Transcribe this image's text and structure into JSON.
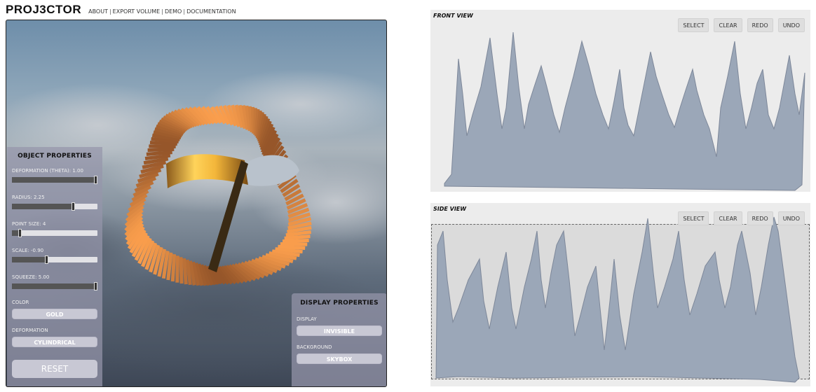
{
  "app": {
    "title": "PROJ3CTOR",
    "nav": [
      "ABOUT",
      "EXPORT VOLUME",
      "DEMO",
      "DOCUMENTATION"
    ],
    "nav_separator": "|"
  },
  "object_properties": {
    "title": "OBJECT PROPERTIES",
    "sliders": [
      {
        "label": "DEFORMATION (THETA): 1.00",
        "level": 1.0
      },
      {
        "label": "RADIUS: 2.25",
        "level": 0.72
      },
      {
        "label": "POINT SIZE: 4",
        "level": 0.1
      },
      {
        "label": "SCALE: -0.90",
        "level": 0.41
      },
      {
        "label": "SQUEEZE: 5.00",
        "level": 1.0
      }
    ],
    "color_label": "COLOR",
    "color_value": "GOLD",
    "deformation_label": "DEFORMATION",
    "deformation_value": "CYLINDRICAL",
    "reset_label": "RESET"
  },
  "display_properties": {
    "title": "DISPLAY PROPERTIES",
    "display_label": "DISPLAY",
    "display_value": "INVISIBLE",
    "background_label": "BACKGROUND",
    "background_value": "SKYBOX"
  },
  "front_view": {
    "title": "FRONT VIEW",
    "buttons": [
      "SELECT",
      "CLEAR",
      "REDO",
      "UNDO"
    ]
  },
  "side_view": {
    "title": "SIDE VIEW",
    "buttons": [
      "SELECT",
      "CLEAR",
      "REDO",
      "UNDO"
    ]
  },
  "colors": {
    "silhouette_fill": "#9ba7b8",
    "silhouette_stroke": "#7d8799",
    "gold": "#d4a04a",
    "panel_bg": "#9696aa"
  }
}
